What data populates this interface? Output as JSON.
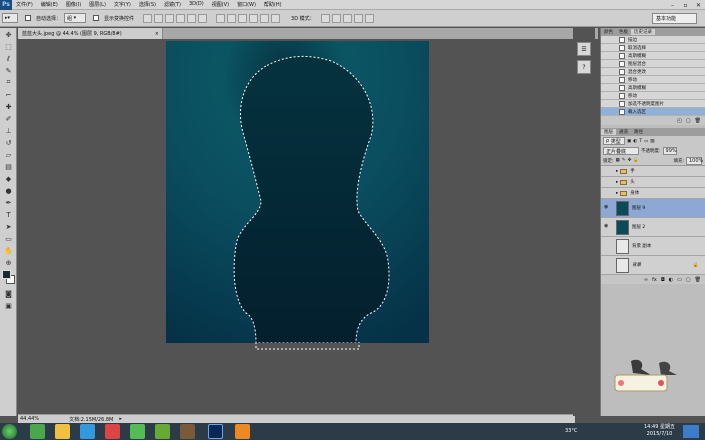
{
  "app": {
    "logo": "Ps"
  },
  "menu": [
    "文件(F)",
    "编辑(E)",
    "图像(I)",
    "图层(L)",
    "文字(Y)",
    "选择(S)",
    "滤镜(T)",
    "3D(D)",
    "视图(V)",
    "窗口(W)",
    "帮助(H)"
  ],
  "options": {
    "auto_select_label": "自动选择：",
    "auto_select_value": "组",
    "show_transform_label": "显示变换控件",
    "mode_label": "3D 模式：",
    "workspace": "基本功能"
  },
  "doc_tab": "蓝蓝大头.jpeg @ 44.4% (图层 9, RGB/8#)",
  "status": {
    "zoom": "44.44%",
    "doc_info": "文档:2.15M/26.8M"
  },
  "history": {
    "tabs": [
      "颜色",
      "色板",
      "历史记录"
    ],
    "items": [
      "描边",
      "取消选择",
      "高斯模糊",
      "图层混合",
      "混合更改",
      "移动",
      "高斯模糊",
      "移动",
      "加选不透明度图片",
      "载入选区"
    ],
    "selected_index": 9
  },
  "layers": {
    "tabs": [
      "图层",
      "通道",
      "路径"
    ],
    "kind_label": "类型",
    "blend_mode": "正片叠底",
    "opacity_label": "不透明度:",
    "opacity_value": "99%",
    "lock_label": "锁定:",
    "fill_label": "填充:",
    "fill_value": "100%",
    "items": [
      {
        "name": "手",
        "type": "group",
        "selected": false
      },
      {
        "name": "头",
        "type": "group",
        "selected": false
      },
      {
        "name": "身体",
        "type": "group",
        "selected": false
      },
      {
        "name": "图层 9",
        "type": "layer",
        "selected": true
      },
      {
        "name": "图层 2",
        "type": "layer",
        "selected": false
      },
      {
        "name": "背景 副本",
        "type": "layer",
        "selected": false
      },
      {
        "name": "背景",
        "type": "layer",
        "selected": false
      }
    ]
  },
  "taskbar": {
    "time": "14:49 星期五",
    "date": "2015/7/10",
    "temperature": "33°C"
  },
  "colors": {
    "canvas_top": "#0d5f6c",
    "canvas_bottom": "#063447",
    "selection": "#ffffff"
  }
}
